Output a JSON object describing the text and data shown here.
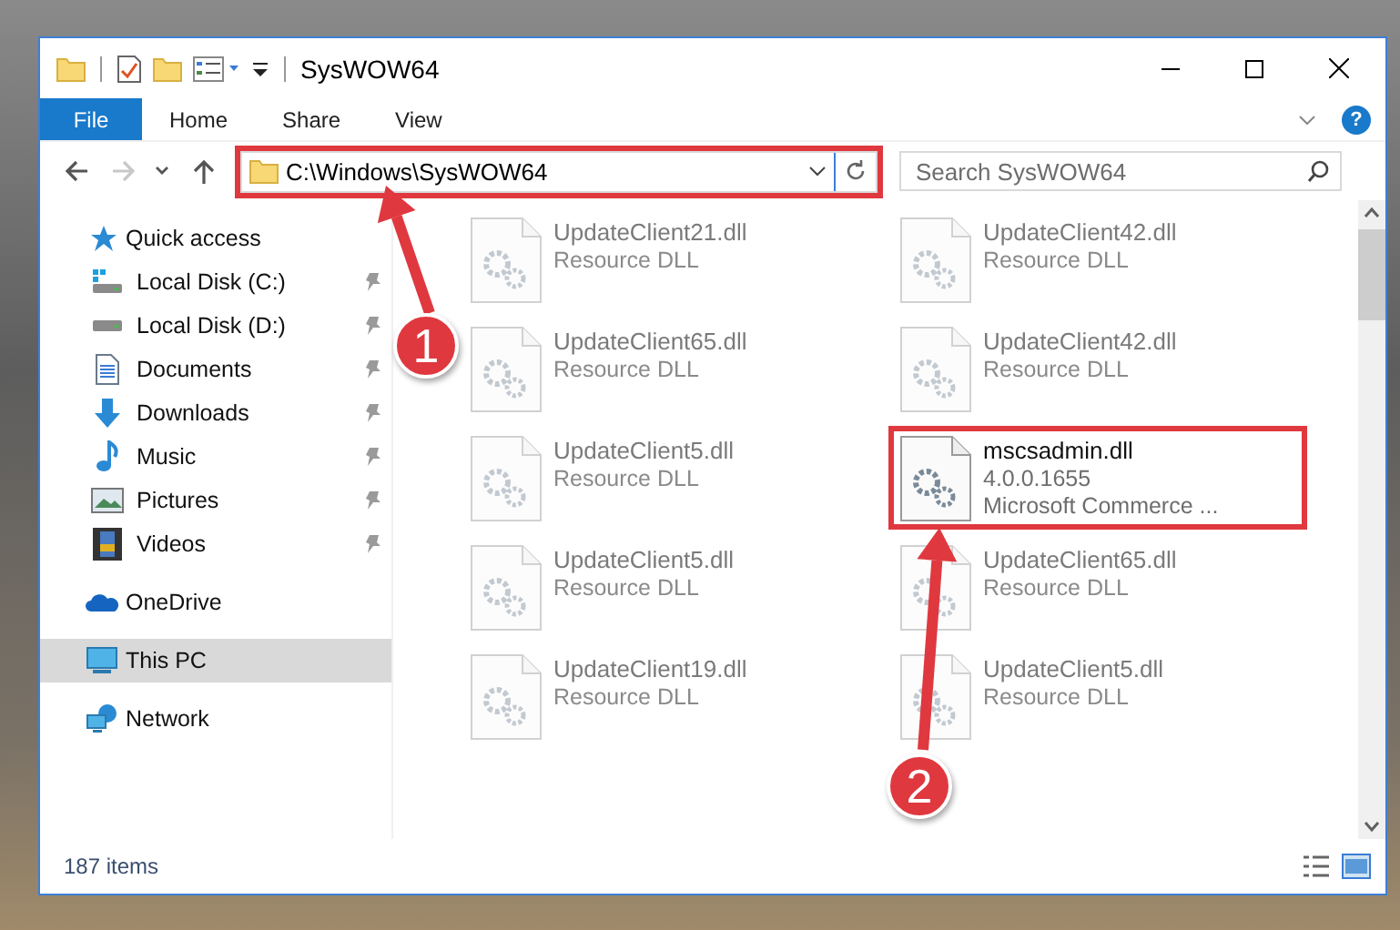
{
  "window": {
    "title": "SysWOW64"
  },
  "ribbon": {
    "tabs": [
      {
        "label": "File",
        "kind": "file",
        "selected": false
      },
      {
        "label": "Home",
        "kind": "tab",
        "selected": false
      },
      {
        "label": "Share",
        "kind": "tab",
        "selected": false
      },
      {
        "label": "View",
        "kind": "tab",
        "selected": false
      }
    ],
    "help": "?"
  },
  "navigation": [
    {
      "kind": "back",
      "disabled": false
    },
    {
      "kind": "forward",
      "disabled": true
    },
    {
      "kind": "recent",
      "disabled": false
    },
    {
      "kind": "up",
      "disabled": false
    }
  ],
  "address_bar": {
    "path": "C:\\Windows\\SysWOW64",
    "highlighted": true
  },
  "search": {
    "placeholder": "Search SysWOW64"
  },
  "sidebar": {
    "items": [
      {
        "label": "Quick access",
        "kind": "quick-access",
        "selected": false,
        "children": [
          {
            "label": "Local Disk (C:)",
            "kind": "system-drive",
            "pinned": true,
            "selected": false
          },
          {
            "label": "Local Disk (D:)",
            "kind": "drive",
            "pinned": true,
            "selected": false
          },
          {
            "label": "Documents",
            "kind": "documents",
            "pinned": true,
            "selected": false
          },
          {
            "label": "Downloads",
            "kind": "downloads",
            "pinned": true,
            "selected": false
          },
          {
            "label": "Music",
            "kind": "music",
            "pinned": true,
            "selected": false
          },
          {
            "label": "Pictures",
            "kind": "pictures",
            "pinned": true,
            "selected": false
          },
          {
            "label": "Videos",
            "kind": "videos",
            "pinned": true,
            "selected": false
          }
        ]
      },
      {
        "label": "OneDrive",
        "kind": "cloud",
        "selected": false
      },
      {
        "label": "This PC",
        "kind": "computer",
        "selected": true
      },
      {
        "label": "Network",
        "kind": "network",
        "selected": false
      }
    ]
  },
  "files": [
    {
      "name": "UpdateClient21.dll",
      "details": [
        "Resource DLL"
      ],
      "blurred": true,
      "highlighted": false
    },
    {
      "name": "UpdateClient42.dll",
      "details": [
        "Resource DLL"
      ],
      "blurred": true,
      "highlighted": false
    },
    {
      "name": "UpdateClient65.dll",
      "details": [
        "Resource DLL"
      ],
      "blurred": true,
      "highlighted": false
    },
    {
      "name": "UpdateClient42.dll",
      "details": [
        "Resource DLL"
      ],
      "blurred": true,
      "highlighted": false
    },
    {
      "name": "UpdateClient5.dll",
      "details": [
        "Resource DLL"
      ],
      "blurred": true,
      "highlighted": false
    },
    {
      "name": "mscsadmin.dll",
      "details": [
        "4.0.0.1655",
        "Microsoft Commerce ..."
      ],
      "blurred": false,
      "highlighted": true
    },
    {
      "name": "UpdateClient5.dll",
      "details": [
        "Resource DLL"
      ],
      "blurred": true,
      "highlighted": false
    },
    {
      "name": "UpdateClient65.dll",
      "details": [
        "Resource DLL"
      ],
      "blurred": true,
      "highlighted": false
    },
    {
      "name": "UpdateClient19.dll",
      "details": [
        "Resource DLL"
      ],
      "blurred": true,
      "highlighted": false
    },
    {
      "name": "UpdateClient5.dll",
      "details": [
        "Resource DLL"
      ],
      "blurred": true,
      "highlighted": false
    }
  ],
  "status_bar": {
    "item_count": "187 items"
  },
  "annotations": [
    {
      "label": "1"
    },
    {
      "label": "2"
    }
  ]
}
